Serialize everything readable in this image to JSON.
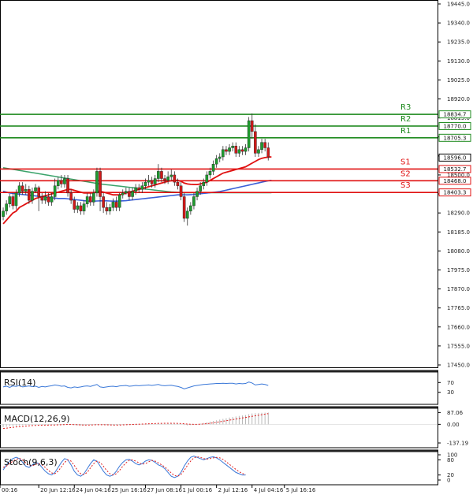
{
  "chart_data": {
    "type": "candlestick",
    "price_axis": {
      "ylim": [
        17450.0,
        19445.0
      ],
      "ticks": [
        "19445.0",
        "19340.0",
        "19235.0",
        "19130.0",
        "19025.0",
        "18920.0",
        "18815.0",
        "18710.0",
        "18605.0",
        "18500.0",
        "18395.0",
        "18290.0",
        "18185.0",
        "18080.0",
        "17975.0",
        "17870.0",
        "17765.0",
        "17660.0",
        "17555.0",
        "17450.0"
      ]
    },
    "time_axis": {
      "labels": [
        "00:16",
        "20 Jun 12:16",
        "24 Jun 04:16",
        "25 Jun 16:16",
        "27 Jun 08:16",
        "1 Jul 00:16",
        "2 Jul 12:16",
        "4 Jul 04:16",
        "5 Jul 16:16"
      ],
      "label_positions": [
        0,
        11,
        22,
        33,
        44,
        55,
        66,
        77,
        87
      ]
    },
    "current_price": "18596.0",
    "current_price_value": 18596.0,
    "levels": [
      {
        "name": "R3",
        "value": 18834.7,
        "label": "18834.7",
        "color": "#1e8a1e"
      },
      {
        "name": "R2",
        "value": 18770.0,
        "label": "18770.0",
        "color": "#1e8a1e"
      },
      {
        "name": "R1",
        "value": 18705.3,
        "label": "18705.3",
        "color": "#1e8a1e"
      },
      {
        "name": "S1",
        "value": 18532.7,
        "label": "18532.7",
        "color": "#e01010"
      },
      {
        "name": "S2",
        "value": 18468.0,
        "label": "18468.0",
        "color": "#e01010"
      },
      {
        "name": "S3",
        "value": 18403.3,
        "label": "18403.3",
        "color": "#e01010"
      }
    ],
    "candles": [
      [
        18270,
        18300,
        18250,
        18320
      ],
      [
        18300,
        18340,
        18280,
        18360
      ],
      [
        18340,
        18380,
        18320,
        18395
      ],
      [
        18380,
        18330,
        18310,
        18400
      ],
      [
        18330,
        18400,
        18310,
        18420
      ],
      [
        18400,
        18440,
        18380,
        18460
      ],
      [
        18440,
        18410,
        18390,
        18460
      ],
      [
        18410,
        18420,
        18390,
        18450
      ],
      [
        18420,
        18360,
        18340,
        18440
      ],
      [
        18360,
        18410,
        18340,
        18430
      ],
      [
        18410,
        18430,
        18400,
        18450
      ],
      [
        18430,
        18380,
        18300,
        18440
      ],
      [
        18380,
        18360,
        18340,
        18400
      ],
      [
        18360,
        18380,
        18340,
        18410
      ],
      [
        18380,
        18350,
        18330,
        18400
      ],
      [
        18350,
        18380,
        18330,
        18400
      ],
      [
        18380,
        18440,
        18360,
        18480
      ],
      [
        18440,
        18470,
        18420,
        18490
      ],
      [
        18470,
        18450,
        18430,
        18500
      ],
      [
        18450,
        18480,
        18430,
        18500
      ],
      [
        18480,
        18400,
        18380,
        18500
      ],
      [
        18400,
        18360,
        18340,
        18420
      ],
      [
        18360,
        18310,
        18290,
        18380
      ],
      [
        18310,
        18330,
        18290,
        18350
      ],
      [
        18330,
        18300,
        18280,
        18350
      ],
      [
        18300,
        18340,
        18280,
        18360
      ],
      [
        18340,
        18380,
        18320,
        18400
      ],
      [
        18380,
        18350,
        18330,
        18400
      ],
      [
        18350,
        18400,
        18330,
        18420
      ],
      [
        18400,
        18520,
        18380,
        18540
      ],
      [
        18520,
        18380,
        18300,
        18540
      ],
      [
        18380,
        18320,
        18290,
        18400
      ],
      [
        18320,
        18300,
        18280,
        18350
      ],
      [
        18300,
        18320,
        18280,
        18340
      ],
      [
        18320,
        18350,
        18300,
        18370
      ],
      [
        18350,
        18320,
        18300,
        18380
      ],
      [
        18320,
        18390,
        18300,
        18400
      ],
      [
        18390,
        18400,
        18370,
        18420
      ],
      [
        18400,
        18410,
        18390,
        18430
      ],
      [
        18410,
        18380,
        18360,
        18430
      ],
      [
        18380,
        18410,
        18360,
        18430
      ],
      [
        18410,
        18430,
        18390,
        18450
      ],
      [
        18430,
        18420,
        18400,
        18450
      ],
      [
        18420,
        18440,
        18400,
        18460
      ],
      [
        18440,
        18460,
        18420,
        18480
      ],
      [
        18460,
        18470,
        18440,
        18500
      ],
      [
        18470,
        18450,
        18430,
        18490
      ],
      [
        18450,
        18480,
        18430,
        18500
      ],
      [
        18480,
        18520,
        18460,
        18560
      ],
      [
        18520,
        18480,
        18460,
        18540
      ],
      [
        18480,
        18470,
        18450,
        18500
      ],
      [
        18470,
        18490,
        18450,
        18520
      ],
      [
        18490,
        18500,
        18470,
        18530
      ],
      [
        18500,
        18460,
        18440,
        18520
      ],
      [
        18460,
        18440,
        18420,
        18480
      ],
      [
        18440,
        18380,
        18360,
        18460
      ],
      [
        18380,
        18260,
        18240,
        18400
      ],
      [
        18260,
        18300,
        18220,
        18320
      ],
      [
        18300,
        18330,
        18280,
        18350
      ],
      [
        18330,
        18380,
        18310,
        18400
      ],
      [
        18380,
        18410,
        18360,
        18430
      ],
      [
        18410,
        18440,
        18390,
        18460
      ],
      [
        18440,
        18460,
        18420,
        18480
      ],
      [
        18460,
        18500,
        18440,
        18520
      ],
      [
        18500,
        18520,
        18480,
        18540
      ],
      [
        18520,
        18560,
        18500,
        18580
      ],
      [
        18560,
        18590,
        18540,
        18610
      ],
      [
        18590,
        18600,
        18570,
        18620
      ],
      [
        18600,
        18640,
        18580,
        18660
      ],
      [
        18640,
        18630,
        18610,
        18660
      ],
      [
        18630,
        18650,
        18610,
        18670
      ],
      [
        18650,
        18660,
        18630,
        18680
      ],
      [
        18660,
        18620,
        18600,
        18680
      ],
      [
        18620,
        18640,
        18600,
        18660
      ],
      [
        18640,
        18630,
        18610,
        18660
      ],
      [
        18630,
        18650,
        18610,
        18670
      ],
      [
        18650,
        18800,
        18630,
        18820
      ],
      [
        18800,
        18740,
        18700,
        18840
      ],
      [
        18740,
        18620,
        18600,
        18780
      ],
      [
        18620,
        18640,
        18600,
        18660
      ],
      [
        18640,
        18680,
        18620,
        18700
      ],
      [
        18680,
        18650,
        18630,
        18700
      ],
      [
        18650,
        18600,
        18580,
        18680
      ]
    ],
    "ma_fast_red": [
      18230,
      18250,
      18270,
      18290,
      18300,
      18320,
      18330,
      18340,
      18350,
      18360,
      18370,
      18375,
      18380,
      18385,
      18390,
      18395,
      18400,
      18405,
      18410,
      18415,
      18420,
      18420,
      18415,
      18410,
      18405,
      18400,
      18400,
      18400,
      18400,
      18410,
      18410,
      18405,
      18400,
      18395,
      18390,
      18390,
      18390,
      18395,
      18400,
      18405,
      18410,
      18415,
      18420,
      18425,
      18430,
      18435,
      18440,
      18445,
      18450,
      18455,
      18460,
      18465,
      18468,
      18470,
      18470,
      18465,
      18455,
      18450,
      18448,
      18447,
      18447,
      18450,
      18455,
      18460,
      18470,
      18480,
      18490,
      18500,
      18510,
      18515,
      18520,
      18525,
      18530,
      18535,
      18540,
      18545,
      18555,
      18565,
      18575,
      18585,
      18592,
      18596,
      18598,
      18600
    ],
    "ma_slow_blue": [
      18410,
      18405,
      18400,
      18398,
      18396,
      18394,
      18392,
      18390,
      18388,
      18386,
      18384,
      18382,
      18380,
      18378,
      18376,
      18374,
      18372,
      18370,
      18370,
      18370,
      18368,
      18366,
      18364,
      18362,
      18360,
      18358,
      18356,
      18355,
      18355,
      18356,
      18357,
      18357,
      18357,
      18356,
      18355,
      18355,
      18356,
      18357,
      18358,
      18360,
      18362,
      18364,
      18366,
      18368,
      18370,
      18372,
      18374,
      18376,
      18378,
      18380,
      18382,
      18384,
      18386,
      18388,
      18390,
      18390,
      18390,
      18390,
      18391,
      18392,
      18394,
      18396,
      18398,
      18400,
      18402,
      18404,
      18406,
      18408,
      18412,
      18416,
      18420,
      18424,
      18428,
      18432,
      18436,
      18440,
      18444,
      18448,
      18452,
      18456,
      18460,
      18464,
      18468,
      18470
    ],
    "ma_green": [
      18540,
      18537,
      18534,
      18531,
      18528,
      18525,
      18522,
      18519,
      18516,
      18513,
      18510,
      18507,
      18504,
      18501,
      18498,
      18495,
      18492,
      18489,
      18486,
      18483,
      18480,
      18477,
      18474,
      18471,
      18468,
      18465,
      18462,
      18459,
      18456,
      18453,
      18450,
      18448,
      18446,
      18444,
      18442,
      18440,
      18438,
      18436,
      18434,
      18432,
      18430,
      18428,
      18426,
      18424,
      18422,
      18420,
      18418,
      18416,
      18414,
      18412,
      18410,
      18408,
      18406,
      18405,
      18404,
      18403,
      18402,
      18402,
      18402,
      18402,
      18402,
      18402,
      18402,
      18402,
      18402,
      18402,
      18402,
      18402,
      18402,
      18402,
      18402,
      18402,
      18402,
      18402,
      18402,
      18402,
      18402,
      18402,
      18402,
      18402,
      18402,
      18402,
      18402,
      18402
    ],
    "indicators": [
      {
        "name": "RSI(14)",
        "ticks": [
          "70",
          "30"
        ],
        "tick_values": [
          70,
          30
        ],
        "ylim": [
          0,
          100
        ],
        "series": [
          {
            "color": "#3a78d8",
            "values": [
              52,
              55,
              50,
              56,
              54,
              58,
              52,
              54,
              56,
              53,
              55,
              50,
              54,
              52,
              55,
              57,
              60,
              58,
              55,
              56,
              50,
              48,
              52,
              50,
              52,
              55,
              56,
              54,
              58,
              62,
              52,
              50,
              52,
              54,
              55,
              53,
              56,
              57,
              58,
              55,
              56,
              58,
              57,
              58,
              59,
              60,
              58,
              60,
              62,
              58,
              57,
              58,
              59,
              56,
              54,
              50,
              44,
              48,
              52,
              56,
              58,
              60,
              62,
              63,
              64,
              65,
              66,
              66,
              67,
              66,
              67,
              67,
              64,
              66,
              65,
              66,
              72,
              68,
              60,
              62,
              64,
              62,
              58
            ]
          }
        ]
      },
      {
        "name": "MACD(12,26,9)",
        "ticks": [
          "87.06",
          "0.00",
          "-137.19"
        ],
        "tick_values": [
          87.06,
          0,
          -137.19
        ],
        "ylim": [
          -137.19,
          95.0
        ],
        "histogram": [
          -20,
          -18,
          -15,
          -12,
          -10,
          -8,
          -6,
          -5,
          -4,
          -3,
          -2,
          -2,
          -3,
          -4,
          -4,
          -3,
          -2,
          0,
          2,
          3,
          1,
          -2,
          -5,
          -7,
          -8,
          -7,
          -5,
          -4,
          -2,
          3,
          0,
          -3,
          -5,
          -6,
          -6,
          -5,
          -4,
          -2,
          0,
          1,
          2,
          3,
          4,
          5,
          6,
          7,
          7,
          8,
          10,
          9,
          8,
          8,
          9,
          7,
          5,
          2,
          -5,
          -8,
          -6,
          -3,
          1,
          5,
          10,
          15,
          20,
          25,
          30,
          35,
          40,
          45,
          50,
          54,
          58,
          62,
          65,
          68,
          75,
          80,
          82,
          84,
          85,
          86,
          87
        ],
        "signal": [
          -30,
          -28,
          -25,
          -22,
          -19,
          -17,
          -15,
          -13,
          -11,
          -9,
          -8,
          -7,
          -6,
          -6,
          -6,
          -5,
          -5,
          -4,
          -3,
          -2,
          -1,
          -1,
          -2,
          -3,
          -4,
          -5,
          -5,
          -5,
          -4,
          -3,
          -3,
          -3,
          -4,
          -4,
          -5,
          -5,
          -5,
          -4,
          -3,
          -2,
          -1,
          0,
          1,
          2,
          3,
          4,
          5,
          6,
          7,
          7,
          8,
          8,
          8,
          8,
          7,
          6,
          4,
          2,
          1,
          0,
          0,
          1,
          3,
          5,
          8,
          11,
          15,
          19,
          23,
          27,
          31,
          35,
          39,
          43,
          47,
          51,
          55,
          59,
          63,
          67,
          71,
          75,
          79
        ]
      },
      {
        "name": "Stoch(9,6,3)",
        "ticks": [
          "100",
          "80",
          "20",
          "0"
        ],
        "tick_values": [
          100,
          80,
          20,
          0
        ],
        "ylim": [
          0,
          100
        ],
        "series": [
          {
            "color": "#3a78d8",
            "values": [
              40,
              60,
              75,
              85,
              90,
              85,
              70,
              55,
              50,
              60,
              70,
              65,
              50,
              35,
              25,
              20,
              30,
              50,
              70,
              85,
              80,
              60,
              35,
              20,
              15,
              25,
              45,
              65,
              80,
              75,
              55,
              35,
              20,
              15,
              20,
              35,
              55,
              70,
              80,
              82,
              75,
              65,
              60,
              65,
              75,
              80,
              78,
              70,
              60,
              55,
              45,
              30,
              15,
              10,
              15,
              30,
              55,
              75,
              90,
              95,
              90,
              85,
              80,
              85,
              90,
              92,
              88,
              80,
              70,
              60,
              50,
              40,
              30,
              25,
              20,
              20
            ]
          },
          {
            "color": "#e02020",
            "values": [
              50,
              55,
              65,
              75,
              82,
              86,
              80,
              68,
              58,
              56,
              62,
              65,
              60,
              50,
              38,
              28,
              25,
              35,
              52,
              70,
              80,
              75,
              58,
              38,
              25,
              22,
              30,
              48,
              65,
              75,
              70,
              55,
              38,
              25,
              20,
              25,
              38,
              55,
              68,
              78,
              80,
              75,
              68,
              63,
              65,
              72,
              78,
              75,
              68,
              60,
              52,
              40,
              28,
              18,
              15,
              22,
              38,
              58,
              75,
              88,
              92,
              90,
              85,
              83,
              85,
              88,
              90,
              88,
              82,
              72,
              62,
              52,
              42,
              33,
              26,
              22
            ]
          }
        ]
      }
    ]
  }
}
